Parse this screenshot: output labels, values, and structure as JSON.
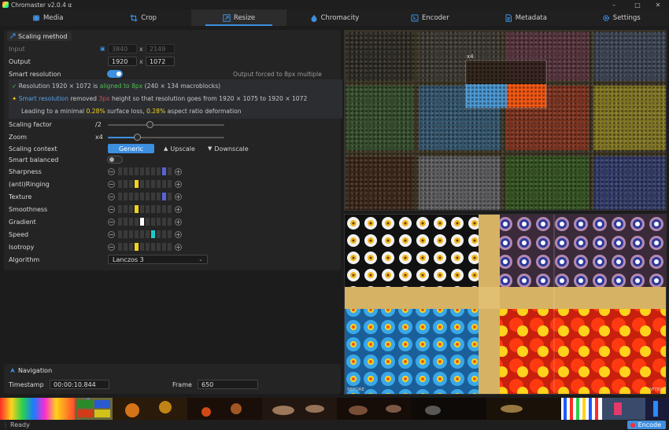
{
  "app": {
    "title": "Chromaster v2.0.4 α"
  },
  "tabs": [
    {
      "label": "Media",
      "icon": "film-icon"
    },
    {
      "label": "Crop",
      "icon": "crop-icon"
    },
    {
      "label": "Resize",
      "icon": "resize-icon"
    },
    {
      "label": "Chromacity",
      "icon": "color-drop-icon"
    },
    {
      "label": "Encoder",
      "icon": "encoder-icon"
    },
    {
      "label": "Metadata",
      "icon": "document-icon"
    },
    {
      "label": "Settings",
      "icon": "gear-icon"
    }
  ],
  "scaling": {
    "header": "Scaling method",
    "input_label": "Input",
    "input_w": "3840",
    "input_h": "2149",
    "output_label": "Output",
    "output_w": "1920",
    "output_h": "1072",
    "x_sep": "x",
    "smart_label": "Smart resolution",
    "smart_on": true,
    "forced_note": "Output forced to 8px multiple",
    "info1": {
      "check": "✓",
      "prefix": "Resolution 1920 × 1072 is",
      "aligned": "aligned to 8px",
      "suffix": "(240 × 134 macroblocks)"
    },
    "info2": {
      "smart": "Smart resolution",
      "removed": "removed",
      "px": "3px",
      "rest": "height so that resolution goes from 1920 × 1075 to 1920 × 1072"
    },
    "info3": {
      "prefix": "Leading to a minimal",
      "loss": "0.28%",
      "mid": "surface loss,",
      "deform": "0.28%",
      "suffix": "aspect ratio deformation"
    },
    "factor_label": "Scaling factor",
    "factor_value": "/2",
    "factor_level": 0.36,
    "zoom_label": "Zoom",
    "zoom_value": "x4",
    "zoom_level": 0.25,
    "context_label": "Scaling context",
    "context_options": [
      "Generic",
      "Upscale",
      "Downscale"
    ],
    "context_selected": "Generic",
    "balanced_label": "Smart balanced",
    "balanced_on": false,
    "algorithm_label": "Algorithm",
    "algorithm_value": "Lanczos 3",
    "params": [
      {
        "label": "Sharpness",
        "level": 9,
        "color": "#5a62d8"
      },
      {
        "label": "(anti)Ringing",
        "level": 4,
        "color": "#f2d21c"
      },
      {
        "label": "Texture",
        "level": 9,
        "color": "#5a62d8"
      },
      {
        "label": "Smoothness",
        "level": 4,
        "color": "#f2d21c"
      },
      {
        "label": "Gradient",
        "level": 5,
        "color": "#ffffff"
      },
      {
        "label": "Speed",
        "level": 7,
        "color": "#1ec9c9"
      },
      {
        "label": "Isotropy",
        "level": 4,
        "color": "#f2d21c"
      }
    ],
    "param_steps": 10
  },
  "navigation": {
    "header": "Navigation",
    "timestamp_label": "Timestamp",
    "timestamp_value": "00:00:10.844",
    "frame_label": "Frame",
    "frame_value": "650"
  },
  "preview": {
    "zoom_badge": "x4",
    "before_label": "BEFORE",
    "after_label": "AFTER"
  },
  "status": {
    "text": "Ready",
    "encode_label": "Encode"
  },
  "colors": {
    "accent": "#3d8fe0",
    "green": "#4fc24f",
    "red": "#e04848",
    "yellow": "#f2d21c",
    "blue_text": "#5aa0e6"
  }
}
